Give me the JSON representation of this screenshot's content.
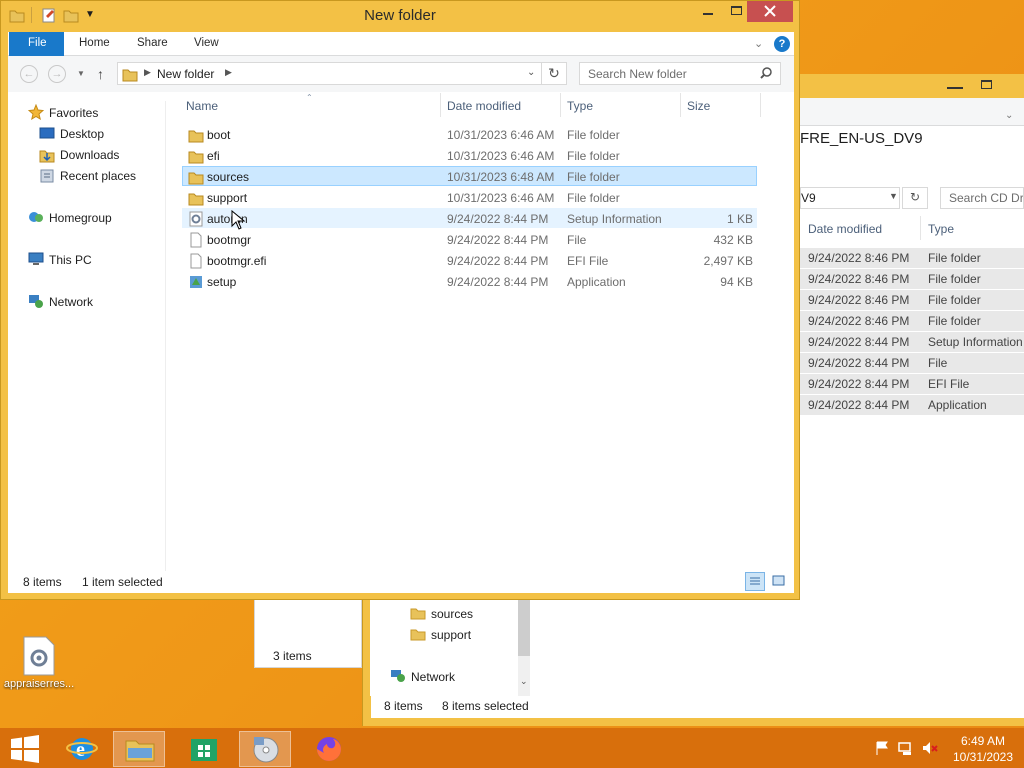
{
  "desktop": {
    "icon_label": "appraiserres..."
  },
  "bg_window": {
    "title": "FRE_EN-US_DV9",
    "address": "V9",
    "search_placeholder": "Search CD Driv",
    "columns": [
      "Date modified",
      "Type"
    ],
    "rows": [
      {
        "date": "9/24/2022 8:46 PM",
        "type": "File folder"
      },
      {
        "date": "9/24/2022 8:46 PM",
        "type": "File folder"
      },
      {
        "date": "9/24/2022 8:46 PM",
        "type": "File folder"
      },
      {
        "date": "9/24/2022 8:46 PM",
        "type": "File folder"
      },
      {
        "date": "9/24/2022 8:44 PM",
        "type": "Setup Information"
      },
      {
        "date": "9/24/2022 8:44 PM",
        "type": "File"
      },
      {
        "date": "9/24/2022 8:44 PM",
        "type": "EFI File"
      },
      {
        "date": "9/24/2022 8:44 PM",
        "type": "Application"
      }
    ],
    "nav_items": [
      "sources",
      "support",
      "Network"
    ],
    "status_items": "8 items",
    "status_selected": "8 items selected",
    "left_status": "3 items"
  },
  "window": {
    "title": "New folder",
    "tabs": {
      "file": "File",
      "home": "Home",
      "share": "Share",
      "view": "View"
    },
    "address": {
      "crumb": "New folder"
    },
    "search_placeholder": "Search New folder",
    "nav": {
      "favorites": "Favorites",
      "desktop": "Desktop",
      "downloads": "Downloads",
      "recent": "Recent places",
      "homegroup": "Homegroup",
      "thispc": "This PC",
      "network": "Network"
    },
    "columns": {
      "name": "Name",
      "date": "Date modified",
      "type": "Type",
      "size": "Size"
    },
    "files": [
      {
        "name": "boot",
        "date": "10/31/2023 6:46 AM",
        "type": "File folder",
        "size": "",
        "icon": "folder-icon"
      },
      {
        "name": "efi",
        "date": "10/31/2023 6:46 AM",
        "type": "File folder",
        "size": "",
        "icon": "folder-icon"
      },
      {
        "name": "sources",
        "date": "10/31/2023 6:48 AM",
        "type": "File folder",
        "size": "",
        "icon": "folder-icon"
      },
      {
        "name": "support",
        "date": "10/31/2023 6:46 AM",
        "type": "File folder",
        "size": "",
        "icon": "folder-icon"
      },
      {
        "name": "autorun",
        "date": "9/24/2022 8:44 PM",
        "type": "Setup Information",
        "size": "1 KB",
        "icon": "setup-info-icon"
      },
      {
        "name": "bootmgr",
        "date": "9/24/2022 8:44 PM",
        "type": "File",
        "size": "432 KB",
        "icon": "blank-file-icon"
      },
      {
        "name": "bootmgr.efi",
        "date": "9/24/2022 8:44 PM",
        "type": "EFI File",
        "size": "2,497 KB",
        "icon": "blank-file-icon"
      },
      {
        "name": "setup",
        "date": "9/24/2022 8:44 PM",
        "type": "Application",
        "size": "94 KB",
        "icon": "setup-app-icon"
      }
    ],
    "status": {
      "count": "8 items",
      "selected": "1 item selected"
    }
  },
  "taskbar": {
    "time": "6:49 AM",
    "date": "10/31/2023"
  },
  "colors": {
    "accent": "#1979ca",
    "selected_row": "#cce8ff",
    "frame": "#f3c145",
    "close": "#c75050",
    "taskbar": "#d86f0c"
  }
}
